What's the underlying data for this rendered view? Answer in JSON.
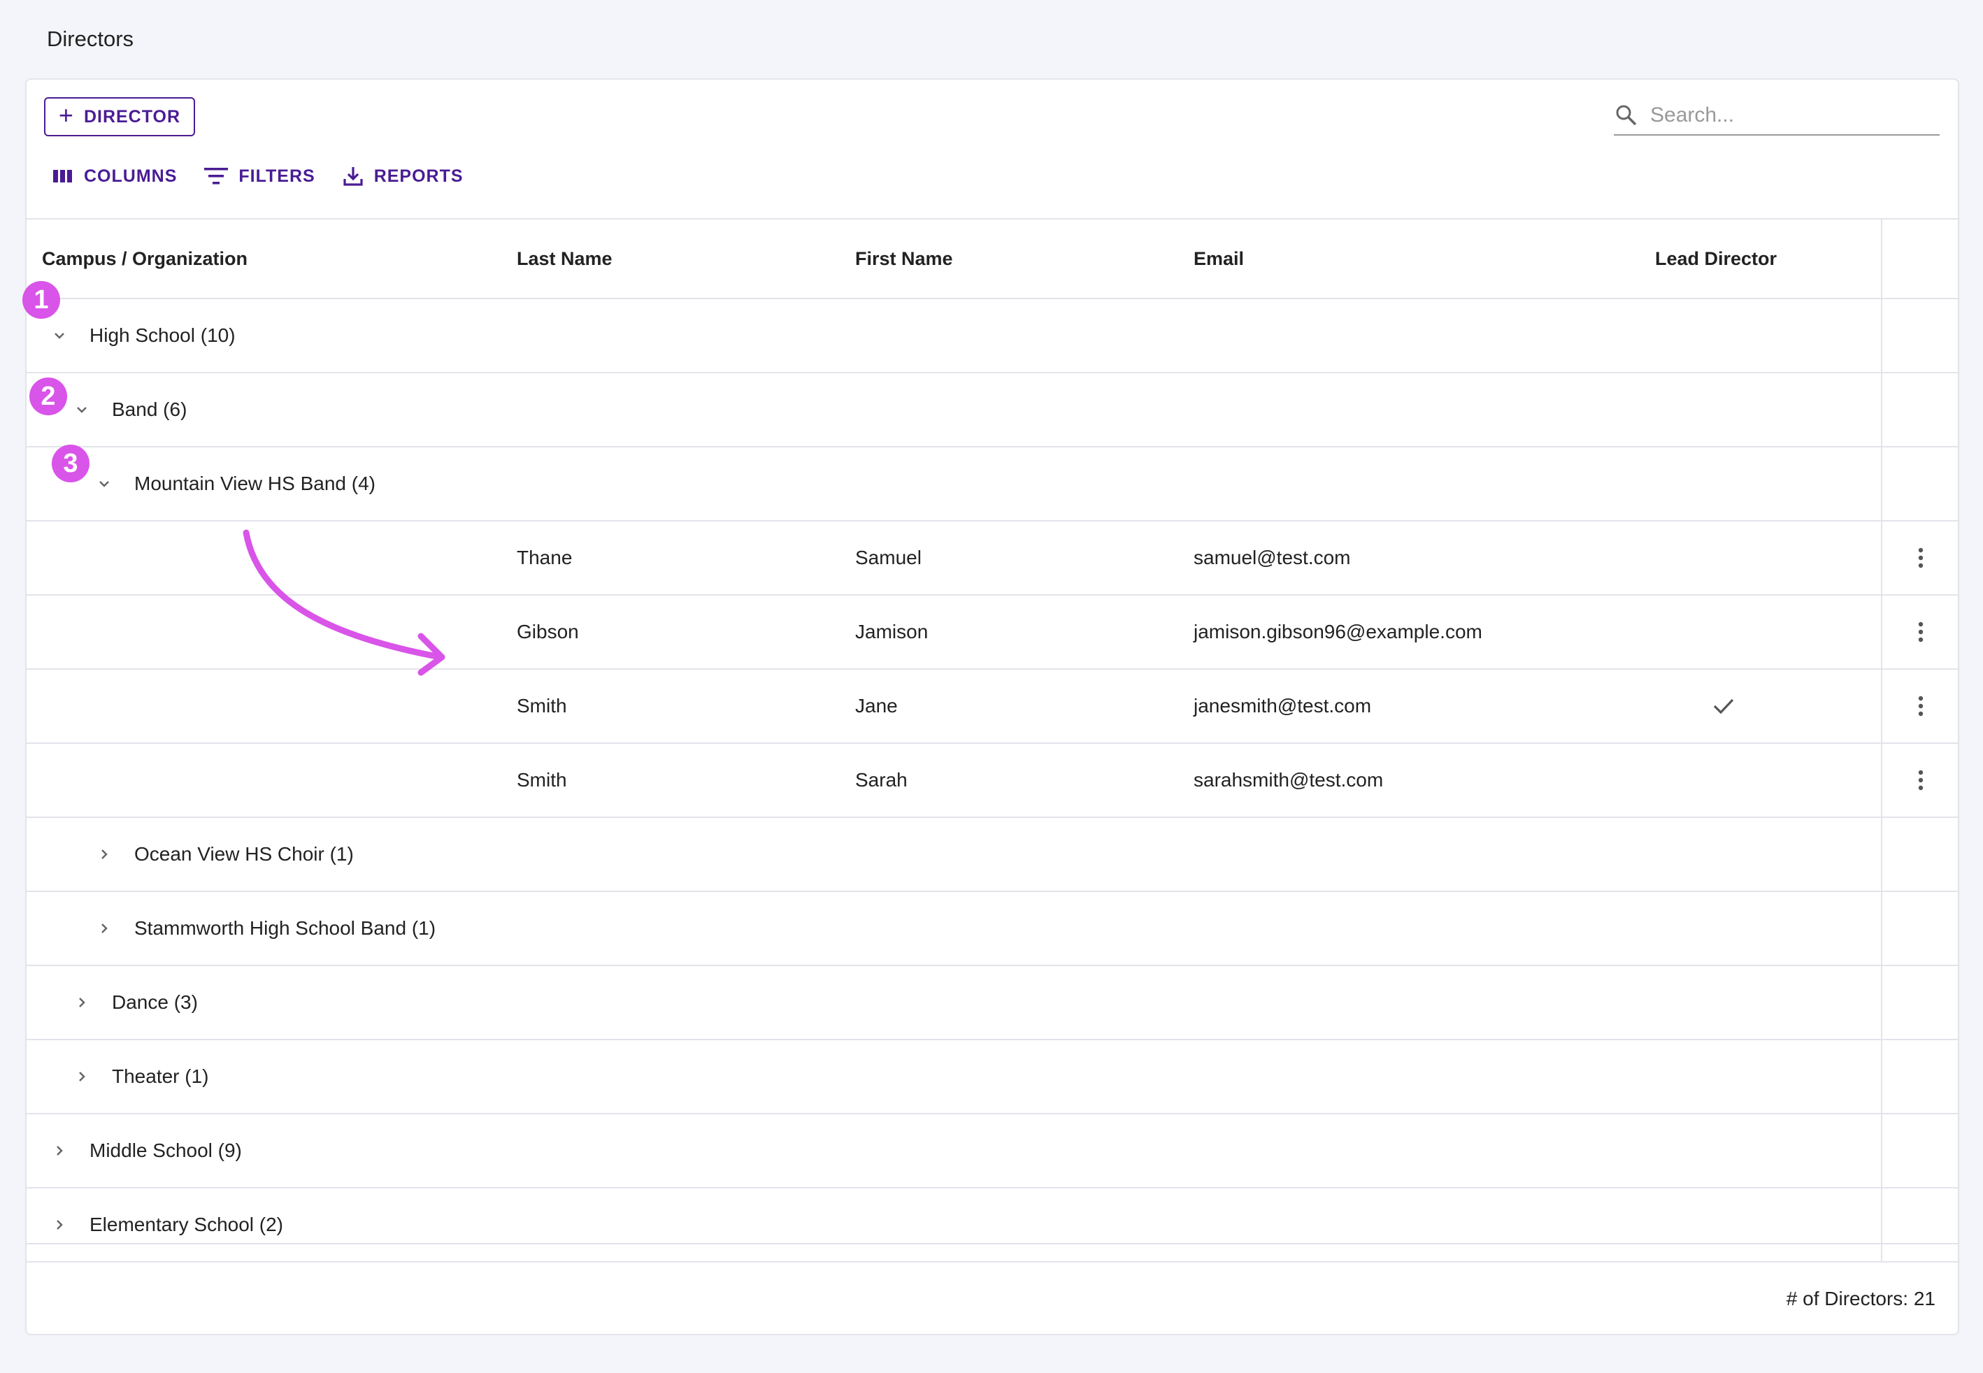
{
  "page": {
    "title": "Directors"
  },
  "toolbar": {
    "add_label": "DIRECTOR",
    "columns_label": "COLUMNS",
    "filters_label": "FILTERS",
    "reports_label": "REPORTS"
  },
  "search": {
    "placeholder": "Search..."
  },
  "table": {
    "headers": {
      "campus": "Campus / Organization",
      "last": "Last Name",
      "first": "First Name",
      "email": "Email",
      "lead": "Lead Director"
    },
    "groups": {
      "high_school": "High School (10)",
      "band": "Band (6)",
      "mountain_view": "Mountain View HS Band (4)",
      "ocean_view": "Ocean View HS Choir (1)",
      "stammworth": "Stammworth High School Band (1)",
      "dance": "Dance (3)",
      "theater": "Theater (1)",
      "middle_school": "Middle School (9)",
      "elementary_school": "Elementary School (2)"
    },
    "rows": [
      {
        "last": "Thane",
        "first": "Samuel",
        "email": "samuel@test.com",
        "lead": false
      },
      {
        "last": "Gibson",
        "first": "Jamison",
        "email": "jamison.gibson96@example.com",
        "lead": false
      },
      {
        "last": "Smith",
        "first": "Jane",
        "email": "janesmith@test.com",
        "lead": true
      },
      {
        "last": "Smith",
        "first": "Sarah",
        "email": "sarahsmith@test.com",
        "lead": false
      }
    ]
  },
  "footer": {
    "count_text": "# of Directors: 21"
  },
  "annotations": {
    "badge1": "1",
    "badge2": "2",
    "badge3": "3"
  },
  "colors": {
    "accent": "#4a1c94",
    "annotation": "#d954e8",
    "border": "#e3e4ea",
    "background": "#f4f5fa"
  },
  "icons": {
    "add": "plus-icon",
    "columns": "columns-icon",
    "filters": "filter-icon",
    "reports": "download-icon",
    "search": "search-icon",
    "expanded": "chevron-down-icon",
    "collapsed": "chevron-right-icon",
    "row_menu": "more-vert-icon",
    "lead": "check-icon"
  }
}
